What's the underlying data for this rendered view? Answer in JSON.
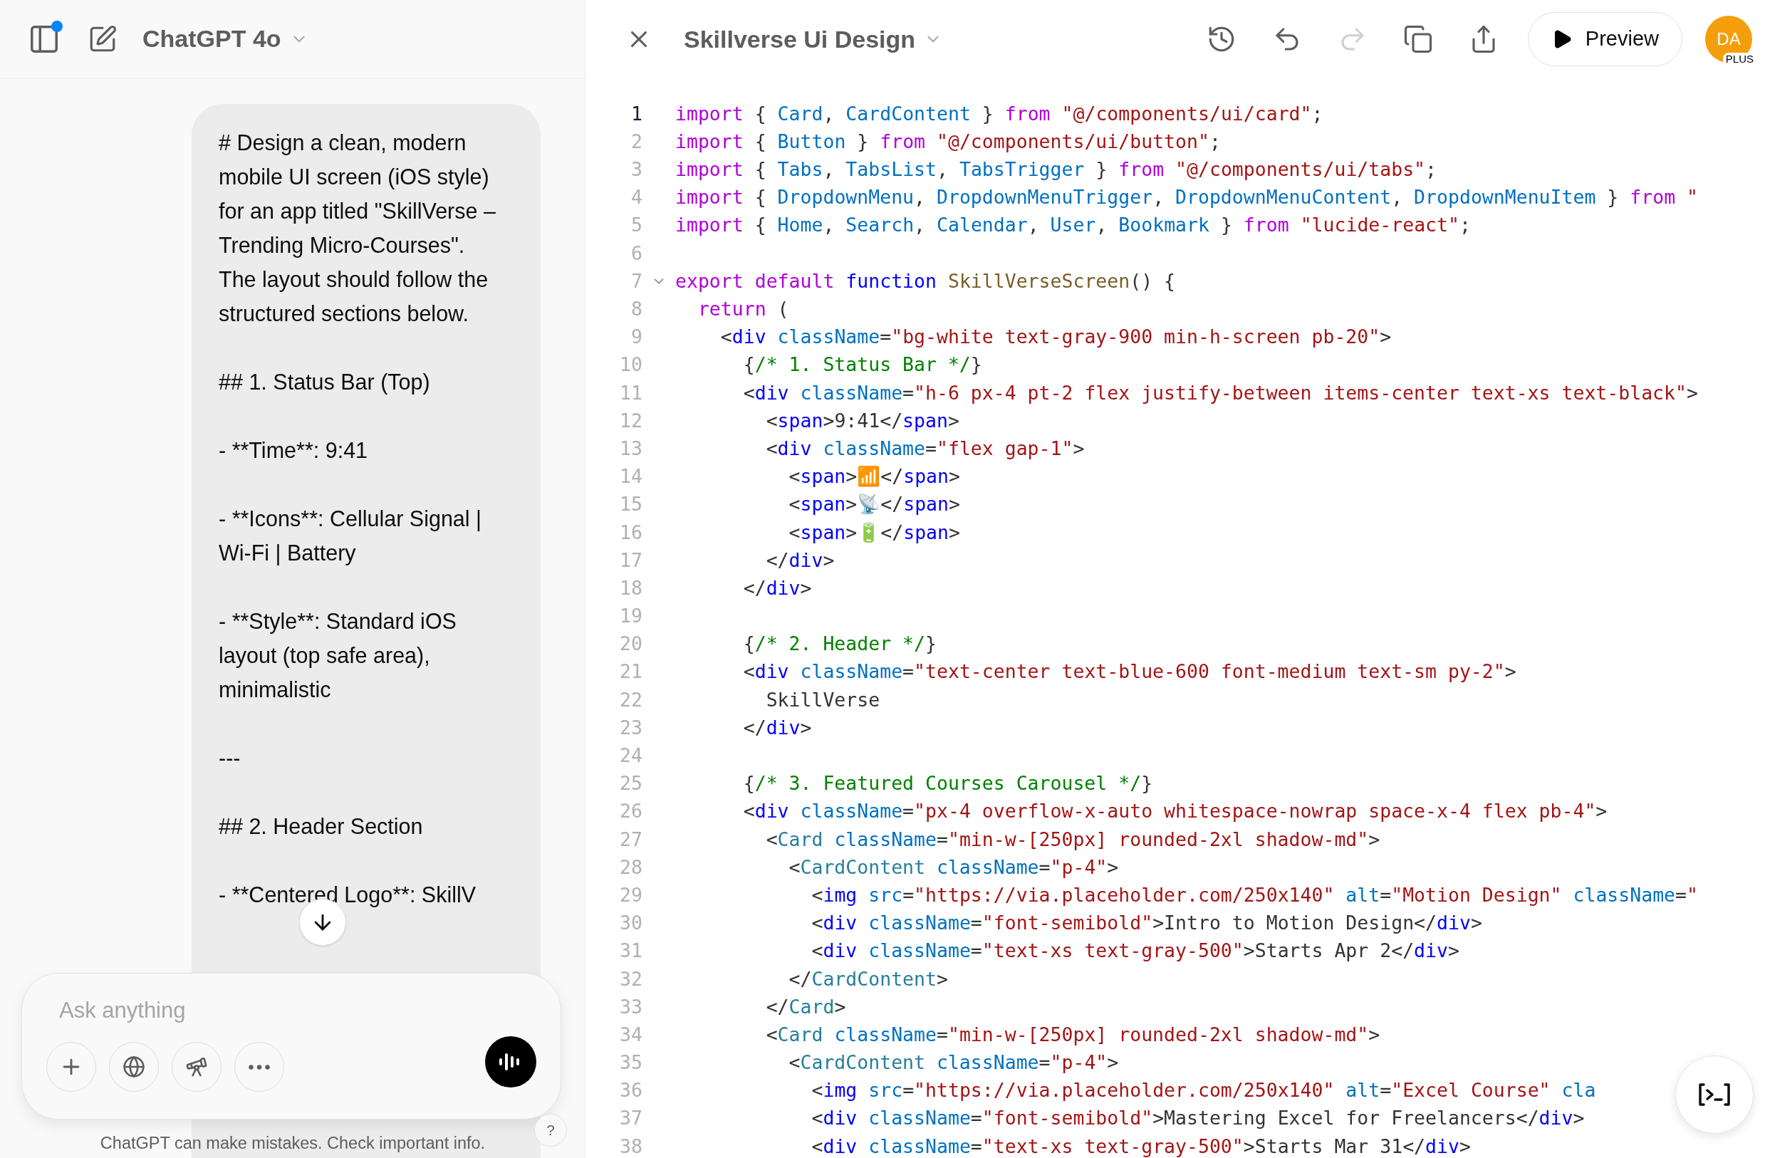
{
  "chat_header": {
    "sidebar_badge": true,
    "model": "ChatGPT 4o"
  },
  "user_message": [
    "# Design a clean, modern mobile UI screen (iOS style) for an app titled \"SkillVerse – Trending Micro-Courses\". The layout should follow the structured sections below.",
    "## 1. Status Bar (Top)",
    "- **Time**: 9:41",
    "- **Icons**: Cellular Signal | Wi-Fi | Battery",
    "- **Style**: Standard iOS layout (top safe area), minimalistic",
    "---",
    "## 2. Header Section",
    "- **Centered Logo**: SkillV"
  ],
  "composer": {
    "placeholder": "Ask anything"
  },
  "disclaimer": "ChatGPT can make mistakes. Check important info.",
  "help": "?",
  "canvas": {
    "title": "Skillverse Ui Design",
    "toolbar": [
      {
        "kind": "history",
        "disabled": false
      },
      {
        "kind": "undo",
        "disabled": false
      },
      {
        "kind": "redo",
        "disabled": true
      },
      {
        "kind": "copy",
        "disabled": false
      },
      {
        "kind": "share",
        "disabled": false
      }
    ],
    "preview": "Preview",
    "avatar": {
      "initials": "DA",
      "plan": "PLUS"
    },
    "code_lines": [
      {
        "number": "1",
        "selected": true,
        "foldable": false,
        "tokens": [
          {
            "kind": "keyword",
            "text": "import"
          },
          {
            "kind": "plain",
            "text": " { "
          },
          {
            "kind": "name",
            "text": "Card"
          },
          {
            "kind": "plain",
            "text": ", "
          },
          {
            "kind": "name",
            "text": "CardContent"
          },
          {
            "kind": "plain",
            "text": " } "
          },
          {
            "kind": "keyword",
            "text": "from"
          },
          {
            "kind": "string",
            "text": " \"@/components/ui/card\""
          },
          {
            "kind": "plain",
            "text": ";"
          }
        ]
      },
      {
        "number": "2",
        "selected": false,
        "foldable": false,
        "tokens": [
          {
            "kind": "keyword",
            "text": "import"
          },
          {
            "kind": "plain",
            "text": " { "
          },
          {
            "kind": "name",
            "text": "Button"
          },
          {
            "kind": "plain",
            "text": " } "
          },
          {
            "kind": "keyword",
            "text": "from"
          },
          {
            "kind": "string",
            "text": " \"@/components/ui/button\""
          },
          {
            "kind": "plain",
            "text": ";"
          }
        ]
      },
      {
        "number": "3",
        "selected": false,
        "foldable": false,
        "tokens": [
          {
            "kind": "keyword",
            "text": "import"
          },
          {
            "kind": "plain",
            "text": " { "
          },
          {
            "kind": "name",
            "text": "Tabs"
          },
          {
            "kind": "plain",
            "text": ", "
          },
          {
            "kind": "name",
            "text": "TabsList"
          },
          {
            "kind": "plain",
            "text": ", "
          },
          {
            "kind": "name",
            "text": "TabsTrigger"
          },
          {
            "kind": "plain",
            "text": " } "
          },
          {
            "kind": "keyword",
            "text": "from"
          },
          {
            "kind": "string",
            "text": " \"@/components/ui/tabs\""
          },
          {
            "kind": "plain",
            "text": ";"
          }
        ]
      },
      {
        "number": "4",
        "selected": false,
        "foldable": false,
        "tokens": [
          {
            "kind": "keyword",
            "text": "import"
          },
          {
            "kind": "plain",
            "text": " { "
          },
          {
            "kind": "name",
            "text": "DropdownMenu"
          },
          {
            "kind": "plain",
            "text": ", "
          },
          {
            "kind": "name",
            "text": "DropdownMenuTrigger"
          },
          {
            "kind": "plain",
            "text": ", "
          },
          {
            "kind": "name",
            "text": "DropdownMenuContent"
          },
          {
            "kind": "plain",
            "text": ", "
          },
          {
            "kind": "name",
            "text": "DropdownMenuItem"
          },
          {
            "kind": "plain",
            "text": " } "
          },
          {
            "kind": "keyword",
            "text": "from"
          },
          {
            "kind": "string",
            "text": " \""
          }
        ]
      },
      {
        "number": "5",
        "selected": false,
        "foldable": false,
        "tokens": [
          {
            "kind": "keyword",
            "text": "import"
          },
          {
            "kind": "plain",
            "text": " { "
          },
          {
            "kind": "name",
            "text": "Home"
          },
          {
            "kind": "plain",
            "text": ", "
          },
          {
            "kind": "name",
            "text": "Search"
          },
          {
            "kind": "plain",
            "text": ", "
          },
          {
            "kind": "name",
            "text": "Calendar"
          },
          {
            "kind": "plain",
            "text": ", "
          },
          {
            "kind": "name",
            "text": "User"
          },
          {
            "kind": "plain",
            "text": ", "
          },
          {
            "kind": "name",
            "text": "Bookmark"
          },
          {
            "kind": "plain",
            "text": " } "
          },
          {
            "kind": "keyword",
            "text": "from"
          },
          {
            "kind": "string",
            "text": " \"lucide-react\""
          },
          {
            "kind": "plain",
            "text": ";"
          }
        ]
      },
      {
        "number": "6",
        "selected": false,
        "foldable": false
      },
      {
        "number": "7",
        "selected": false,
        "foldable": true,
        "tokens": [
          {
            "kind": "keyword",
            "text": "export default"
          },
          {
            "kind": "storage",
            "text": " function"
          },
          {
            "kind": "function",
            "text": " SkillVerseScreen"
          },
          {
            "kind": "plain",
            "text": "() {"
          }
        ]
      },
      {
        "number": "8",
        "selected": false,
        "foldable": false,
        "tokens": [
          {
            "kind": "keyword",
            "text": "  return"
          },
          {
            "kind": "plain",
            "text": " ("
          }
        ]
      },
      {
        "number": "9",
        "selected": false,
        "foldable": false,
        "tokens": [
          {
            "kind": "plain",
            "text": "    <"
          },
          {
            "kind": "tag",
            "text": "div"
          },
          {
            "kind": "attr",
            "text": " className"
          },
          {
            "kind": "plain",
            "text": "="
          },
          {
            "kind": "string",
            "text": "\"bg-white text-gray-900 min-h-screen pb-20\""
          },
          {
            "kind": "plain",
            "text": ">"
          }
        ]
      },
      {
        "number": "10",
        "selected": false,
        "foldable": false,
        "tokens": [
          {
            "kind": "plain",
            "text": "      {"
          },
          {
            "kind": "comment",
            "text": "/* 1. Status Bar */"
          },
          {
            "kind": "plain",
            "text": "}"
          }
        ]
      },
      {
        "number": "11",
        "selected": false,
        "foldable": false,
        "tokens": [
          {
            "kind": "plain",
            "text": "      <"
          },
          {
            "kind": "tag",
            "text": "div"
          },
          {
            "kind": "attr",
            "text": " className"
          },
          {
            "kind": "plain",
            "text": "="
          },
          {
            "kind": "string",
            "text": "\"h-6 px-4 pt-2 flex justify-between items-center text-xs text-black\""
          },
          {
            "kind": "plain",
            "text": ">"
          }
        ]
      },
      {
        "number": "12",
        "selected": false,
        "foldable": false,
        "tokens": [
          {
            "kind": "plain",
            "text": "        <"
          },
          {
            "kind": "tag",
            "text": "span"
          },
          {
            "kind": "plain",
            "text": ">9:41</"
          },
          {
            "kind": "tag",
            "text": "span"
          },
          {
            "kind": "plain",
            "text": ">"
          }
        ]
      },
      {
        "number": "13",
        "selected": false,
        "foldable": false,
        "tokens": [
          {
            "kind": "plain",
            "text": "        <"
          },
          {
            "kind": "tag",
            "text": "div"
          },
          {
            "kind": "attr",
            "text": " className"
          },
          {
            "kind": "plain",
            "text": "="
          },
          {
            "kind": "string",
            "text": "\"flex gap-1\""
          },
          {
            "kind": "plain",
            "text": ">"
          }
        ]
      },
      {
        "number": "14",
        "selected": false,
        "foldable": false,
        "tokens": [
          {
            "kind": "plain",
            "text": "          <"
          },
          {
            "kind": "tag",
            "text": "span"
          },
          {
            "kind": "plain",
            "text": ">📶</"
          },
          {
            "kind": "tag",
            "text": "span"
          },
          {
            "kind": "plain",
            "text": ">"
          }
        ]
      },
      {
        "number": "15",
        "selected": false,
        "foldable": false,
        "tokens": [
          {
            "kind": "plain",
            "text": "          <"
          },
          {
            "kind": "tag",
            "text": "span"
          },
          {
            "kind": "plain",
            "text": ">📡</"
          },
          {
            "kind": "tag",
            "text": "span"
          },
          {
            "kind": "plain",
            "text": ">"
          }
        ]
      },
      {
        "number": "16",
        "selected": false,
        "foldable": false,
        "tokens": [
          {
            "kind": "plain",
            "text": "          <"
          },
          {
            "kind": "tag",
            "text": "span"
          },
          {
            "kind": "plain",
            "text": ">🔋</"
          },
          {
            "kind": "tag",
            "text": "span"
          },
          {
            "kind": "plain",
            "text": ">"
          }
        ]
      },
      {
        "number": "17",
        "selected": false,
        "foldable": false,
        "tokens": [
          {
            "kind": "plain",
            "text": "        </"
          },
          {
            "kind": "tag",
            "text": "div"
          },
          {
            "kind": "plain",
            "text": ">"
          }
        ]
      },
      {
        "number": "18",
        "selected": false,
        "foldable": false,
        "tokens": [
          {
            "kind": "plain",
            "text": "      </"
          },
          {
            "kind": "tag",
            "text": "div"
          },
          {
            "kind": "plain",
            "text": ">"
          }
        ]
      },
      {
        "number": "19",
        "selected": false,
        "foldable": false
      },
      {
        "number": "20",
        "selected": false,
        "foldable": false,
        "tokens": [
          {
            "kind": "plain",
            "text": "      {"
          },
          {
            "kind": "comment",
            "text": "/* 2. Header */"
          },
          {
            "kind": "plain",
            "text": "}"
          }
        ]
      },
      {
        "number": "21",
        "selected": false,
        "foldable": false,
        "tokens": [
          {
            "kind": "plain",
            "text": "      <"
          },
          {
            "kind": "tag",
            "text": "div"
          },
          {
            "kind": "attr",
            "text": " className"
          },
          {
            "kind": "plain",
            "text": "="
          },
          {
            "kind": "string",
            "text": "\"text-center text-blue-600 font-medium text-sm py-2\""
          },
          {
            "kind": "plain",
            "text": ">"
          }
        ]
      },
      {
        "number": "22",
        "selected": false,
        "foldable": false,
        "tokens": [
          {
            "kind": "plain",
            "text": "        SkillVerse"
          }
        ]
      },
      {
        "number": "23",
        "selected": false,
        "foldable": false,
        "tokens": [
          {
            "kind": "plain",
            "text": "      </"
          },
          {
            "kind": "tag",
            "text": "div"
          },
          {
            "kind": "plain",
            "text": ">"
          }
        ]
      },
      {
        "number": "24",
        "selected": false,
        "foldable": false
      },
      {
        "number": "25",
        "selected": false,
        "foldable": false,
        "tokens": [
          {
            "kind": "plain",
            "text": "      {"
          },
          {
            "kind": "comment",
            "text": "/* 3. Featured Courses Carousel */"
          },
          {
            "kind": "plain",
            "text": "}"
          }
        ]
      },
      {
        "number": "26",
        "selected": false,
        "foldable": false,
        "tokens": [
          {
            "kind": "plain",
            "text": "      <"
          },
          {
            "kind": "tag",
            "text": "div"
          },
          {
            "kind": "attr",
            "text": " className"
          },
          {
            "kind": "plain",
            "text": "="
          },
          {
            "kind": "string",
            "text": "\"px-4 overflow-x-auto whitespace-nowrap space-x-4 flex pb-4\""
          },
          {
            "kind": "plain",
            "text": ">"
          }
        ]
      },
      {
        "number": "27",
        "selected": false,
        "foldable": false,
        "tokens": [
          {
            "kind": "plain",
            "text": "        <"
          },
          {
            "kind": "component",
            "text": "Card"
          },
          {
            "kind": "attr",
            "text": " className"
          },
          {
            "kind": "plain",
            "text": "="
          },
          {
            "kind": "string",
            "text": "\"min-w-[250px] rounded-2xl shadow-md\""
          },
          {
            "kind": "plain",
            "text": ">"
          }
        ]
      },
      {
        "number": "28",
        "selected": false,
        "foldable": false,
        "tokens": [
          {
            "kind": "plain",
            "text": "          <"
          },
          {
            "kind": "component",
            "text": "CardContent"
          },
          {
            "kind": "attr",
            "text": " className"
          },
          {
            "kind": "plain",
            "text": "="
          },
          {
            "kind": "string",
            "text": "\"p-4\""
          },
          {
            "kind": "plain",
            "text": ">"
          }
        ]
      },
      {
        "number": "29",
        "selected": false,
        "foldable": false,
        "tokens": [
          {
            "kind": "plain",
            "text": "            <"
          },
          {
            "kind": "tag",
            "text": "img"
          },
          {
            "kind": "attr",
            "text": " src"
          },
          {
            "kind": "plain",
            "text": "="
          },
          {
            "kind": "string",
            "text": "\"https://via.placeholder.com/250x140\""
          },
          {
            "kind": "attr",
            "text": " alt"
          },
          {
            "kind": "plain",
            "text": "="
          },
          {
            "kind": "string",
            "text": "\"Motion Design\""
          },
          {
            "kind": "attr",
            "text": " className"
          },
          {
            "kind": "plain",
            "text": "="
          },
          {
            "kind": "string",
            "text": "\""
          }
        ]
      },
      {
        "number": "30",
        "selected": false,
        "foldable": false,
        "tokens": [
          {
            "kind": "plain",
            "text": "            <"
          },
          {
            "kind": "tag",
            "text": "div"
          },
          {
            "kind": "attr",
            "text": " className"
          },
          {
            "kind": "plain",
            "text": "="
          },
          {
            "kind": "string",
            "text": "\"font-semibold\""
          },
          {
            "kind": "plain",
            "text": ">Intro to Motion Design</"
          },
          {
            "kind": "tag",
            "text": "div"
          },
          {
            "kind": "plain",
            "text": ">"
          }
        ]
      },
      {
        "number": "31",
        "selected": false,
        "foldable": false,
        "tokens": [
          {
            "kind": "plain",
            "text": "            <"
          },
          {
            "kind": "tag",
            "text": "div"
          },
          {
            "kind": "attr",
            "text": " className"
          },
          {
            "kind": "plain",
            "text": "="
          },
          {
            "kind": "string",
            "text": "\"text-xs text-gray-500\""
          },
          {
            "kind": "plain",
            "text": ">Starts Apr 2</"
          },
          {
            "kind": "tag",
            "text": "div"
          },
          {
            "kind": "plain",
            "text": ">"
          }
        ]
      },
      {
        "number": "32",
        "selected": false,
        "foldable": false,
        "tokens": [
          {
            "kind": "plain",
            "text": "          </"
          },
          {
            "kind": "component",
            "text": "CardContent"
          },
          {
            "kind": "plain",
            "text": ">"
          }
        ]
      },
      {
        "number": "33",
        "selected": false,
        "foldable": false,
        "tokens": [
          {
            "kind": "plain",
            "text": "        </"
          },
          {
            "kind": "component",
            "text": "Card"
          },
          {
            "kind": "plain",
            "text": ">"
          }
        ]
      },
      {
        "number": "34",
        "selected": false,
        "foldable": false,
        "tokens": [
          {
            "kind": "plain",
            "text": "        <"
          },
          {
            "kind": "component",
            "text": "Card"
          },
          {
            "kind": "attr",
            "text": " className"
          },
          {
            "kind": "plain",
            "text": "="
          },
          {
            "kind": "string",
            "text": "\"min-w-[250px] rounded-2xl shadow-md\""
          },
          {
            "kind": "plain",
            "text": ">"
          }
        ]
      },
      {
        "number": "35",
        "selected": false,
        "foldable": false,
        "tokens": [
          {
            "kind": "plain",
            "text": "          <"
          },
          {
            "kind": "component",
            "text": "CardContent"
          },
          {
            "kind": "attr",
            "text": " className"
          },
          {
            "kind": "plain",
            "text": "="
          },
          {
            "kind": "string",
            "text": "\"p-4\""
          },
          {
            "kind": "plain",
            "text": ">"
          }
        ]
      },
      {
        "number": "36",
        "selected": false,
        "foldable": false,
        "tokens": [
          {
            "kind": "plain",
            "text": "            <"
          },
          {
            "kind": "tag",
            "text": "img"
          },
          {
            "kind": "attr",
            "text": " src"
          },
          {
            "kind": "plain",
            "text": "="
          },
          {
            "kind": "string",
            "text": "\"https://via.placeholder.com/250x140\""
          },
          {
            "kind": "attr",
            "text": " alt"
          },
          {
            "kind": "plain",
            "text": "="
          },
          {
            "kind": "string",
            "text": "\"Excel Course\""
          },
          {
            "kind": "attr",
            "text": " cla"
          }
        ]
      },
      {
        "number": "37",
        "selected": false,
        "foldable": false,
        "tokens": [
          {
            "kind": "plain",
            "text": "            <"
          },
          {
            "kind": "tag",
            "text": "div"
          },
          {
            "kind": "attr",
            "text": " className"
          },
          {
            "kind": "plain",
            "text": "="
          },
          {
            "kind": "string",
            "text": "\"font-semibold\""
          },
          {
            "kind": "plain",
            "text": ">Mastering Excel for Freelancers</"
          },
          {
            "kind": "tag",
            "text": "div"
          },
          {
            "kind": "plain",
            "text": ">"
          }
        ]
      },
      {
        "number": "38",
        "selected": false,
        "foldable": false,
        "tokens": [
          {
            "kind": "plain",
            "text": "            <"
          },
          {
            "kind": "tag",
            "text": "div"
          },
          {
            "kind": "attr",
            "text": " className"
          },
          {
            "kind": "plain",
            "text": "="
          },
          {
            "kind": "string",
            "text": "\"text-xs text-gray-500\""
          },
          {
            "kind": "plain",
            "text": ">Starts Mar 31</"
          },
          {
            "kind": "tag",
            "text": "div"
          },
          {
            "kind": "plain",
            "text": ">"
          }
        ]
      }
    ]
  }
}
